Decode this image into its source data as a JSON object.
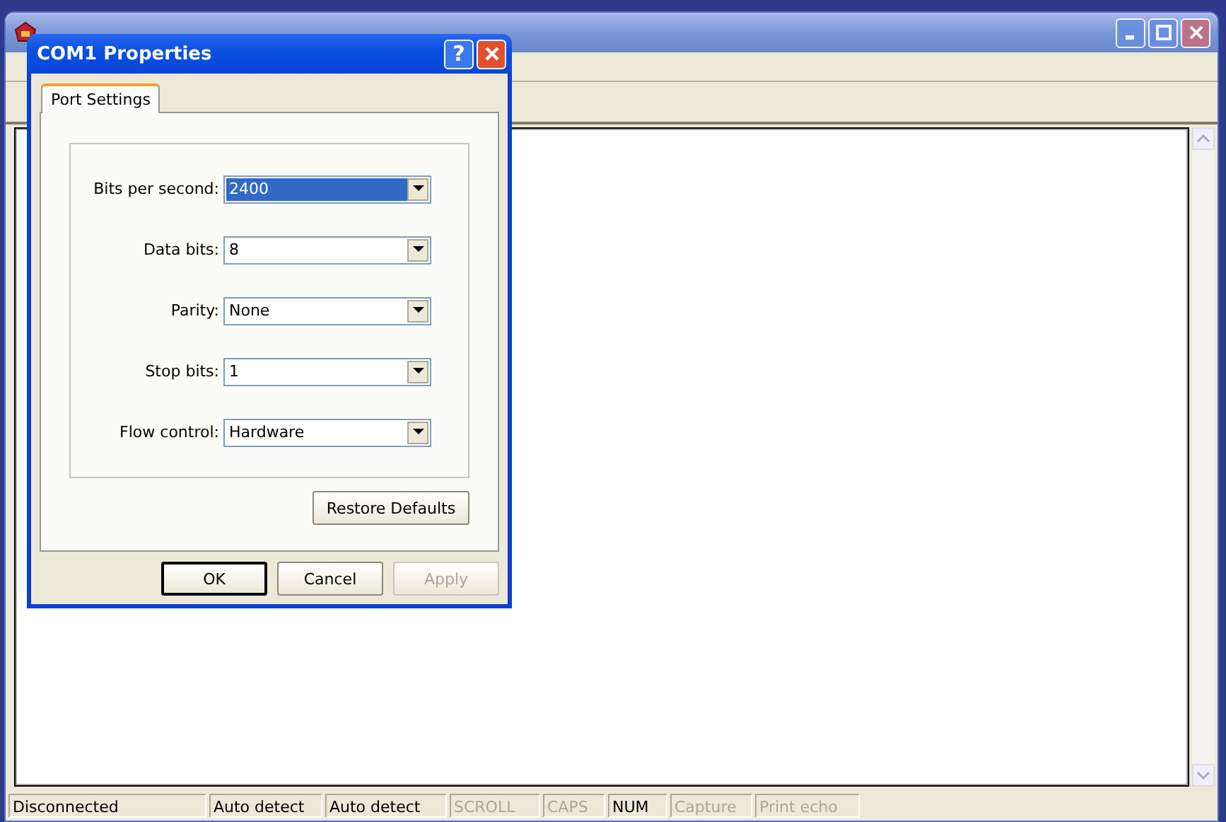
{
  "dialog": {
    "title": "COM1 Properties",
    "help_button": "?",
    "tabs": [
      {
        "label": "Port Settings",
        "selected": true
      }
    ],
    "fields": [
      {
        "label": "Bits per second:",
        "value": "2400",
        "selected": true
      },
      {
        "label": "Data bits:",
        "value": "8",
        "selected": false
      },
      {
        "label": "Parity:",
        "value": "None",
        "selected": false
      },
      {
        "label": "Stop bits:",
        "value": "1",
        "selected": false
      },
      {
        "label": "Flow control:",
        "value": "Hardware",
        "selected": false
      }
    ],
    "restore_button": "Restore Defaults",
    "buttons": [
      {
        "label": "OK",
        "disabled": false
      },
      {
        "label": "Cancel",
        "disabled": false
      },
      {
        "label": "Apply",
        "disabled": true
      }
    ]
  },
  "status_bar": [
    {
      "text": "Disconnected",
      "disabled": false
    },
    {
      "text": "Auto detect",
      "disabled": false
    },
    {
      "text": "Auto detect",
      "disabled": false
    },
    {
      "text": "SCROLL",
      "disabled": true
    },
    {
      "text": "CAPS",
      "disabled": true
    },
    {
      "text": "NUM",
      "disabled": false
    },
    {
      "text": "Capture",
      "disabled": true
    },
    {
      "text": "Print echo",
      "disabled": true
    }
  ]
}
